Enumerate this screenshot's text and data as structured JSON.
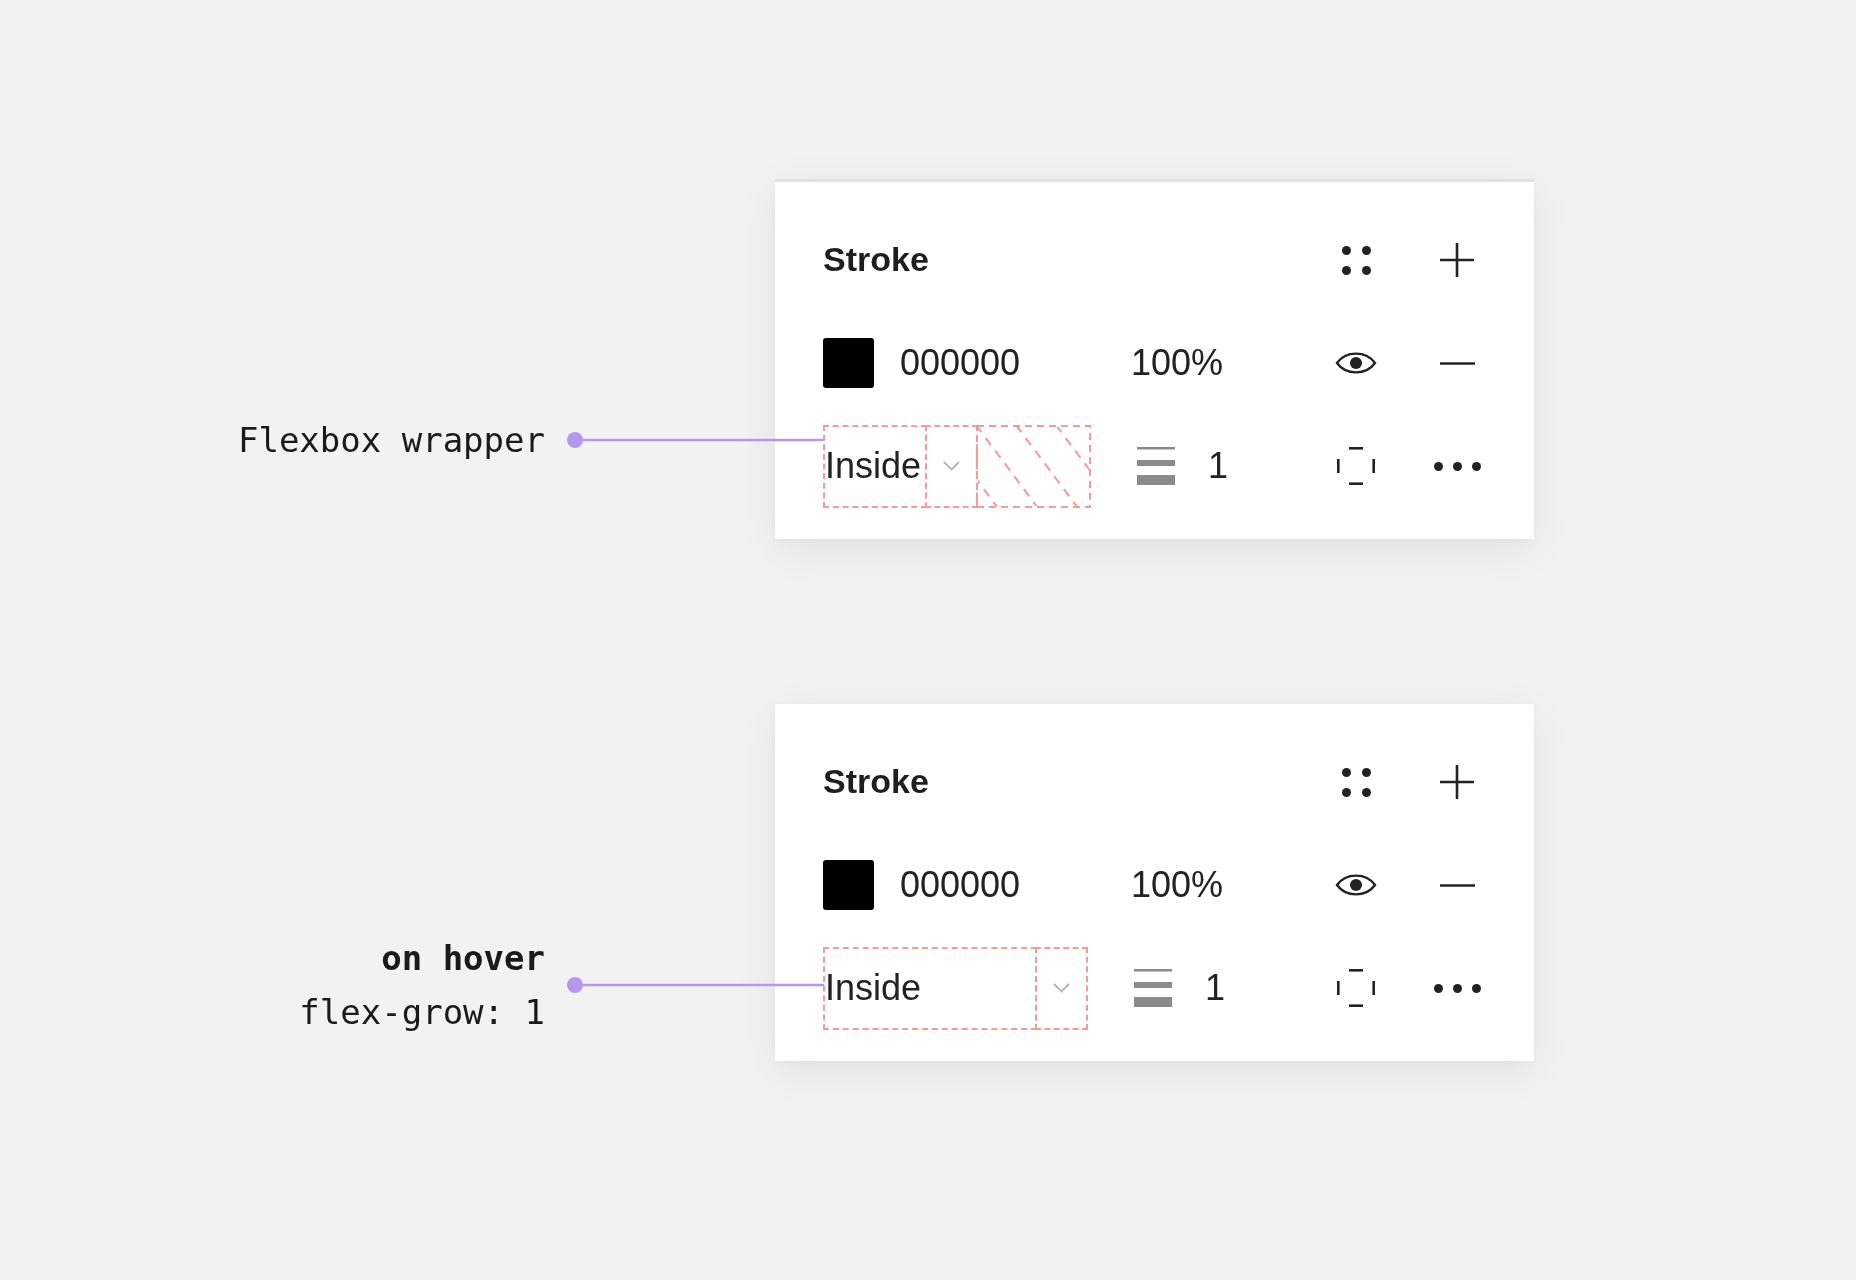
{
  "figures": [
    {
      "annotation": {
        "lines": [
          {
            "text": "Flexbox wrapper",
            "bold": false
          }
        ]
      },
      "panel": {
        "top_border": true,
        "title": "Stroke",
        "fill": {
          "color": "#000000",
          "hex": "000000",
          "opacity": "100%",
          "visible": true
        },
        "stroke": {
          "segments": [
            {
              "kind": "label",
              "text": "Inside",
              "grow": false
            },
            {
              "kind": "chevron"
            },
            {
              "kind": "spacer"
            }
          ],
          "weight": "1"
        }
      }
    },
    {
      "annotation": {
        "lines": [
          {
            "text": "on hover",
            "bold": true
          },
          {
            "text": "flex-grow: 1",
            "bold": false
          }
        ]
      },
      "panel": {
        "top_border": false,
        "title": "Stroke",
        "fill": {
          "color": "#000000",
          "hex": "000000",
          "opacity": "100%",
          "visible": true
        },
        "stroke": {
          "segments": [
            {
              "kind": "label",
              "text": "Inside",
              "grow": true
            },
            {
              "kind": "chevron"
            }
          ],
          "weight": "1"
        }
      }
    }
  ]
}
